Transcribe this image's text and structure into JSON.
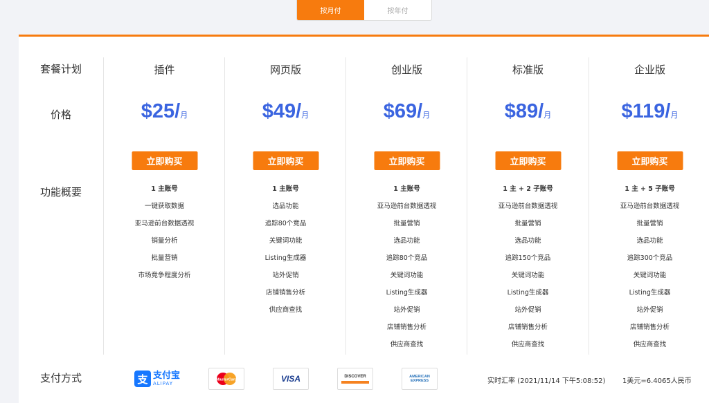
{
  "billing_toggle": {
    "monthly": "按月付",
    "yearly": "按年付"
  },
  "labels": {
    "plan": "套餐计划",
    "price": "价格",
    "features": "功能概要",
    "payment": "支付方式"
  },
  "plans": [
    {
      "name": "插件",
      "price": "$25/",
      "unit": "月",
      "buy": "立即购买",
      "features": [
        "1 主账号",
        "一键获取数据",
        "亚马逊前台数据透视",
        "销量分析",
        "批量营销",
        "市场竞争程度分析"
      ]
    },
    {
      "name": "网页版",
      "price": "$49/",
      "unit": "月",
      "buy": "立即购买",
      "features": [
        "1 主账号",
        "选品功能",
        "追踪80个竞品",
        "关键词功能",
        "Listing生成器",
        "站外促销",
        "店铺销售分析",
        "供应商查找"
      ]
    },
    {
      "name": "创业版",
      "price": "$69/",
      "unit": "月",
      "buy": "立即购买",
      "features": [
        "1 主账号",
        "亚马逊前台数据透视",
        "批量营销",
        "选品功能",
        "追踪80个竞品",
        "关键词功能",
        "Listing生成器",
        "站外促销",
        "店铺销售分析",
        "供应商查找"
      ]
    },
    {
      "name": "标准版",
      "price": "$89/",
      "unit": "月",
      "buy": "立即购买",
      "features": [
        "1 主 + 2 子账号",
        "亚马逊前台数据透视",
        "批量营销",
        "选品功能",
        "追踪150个竞品",
        "关键词功能",
        "Listing生成器",
        "站外促销",
        "店铺销售分析",
        "供应商查找"
      ]
    },
    {
      "name": "企业版",
      "price": "$119/",
      "unit": "月",
      "buy": "立即购买",
      "features": [
        "1 主 + 5 子账号",
        "亚马逊前台数据透视",
        "批量营销",
        "选品功能",
        "追踪300个竞品",
        "关键词功能",
        "Listing生成器",
        "站外促销",
        "店铺销售分析",
        "供应商查找"
      ]
    }
  ],
  "payment": {
    "alipay_glyph": "支",
    "alipay_cn": "支付宝",
    "alipay_en": "ALIPAY",
    "mastercard": "MasterCard",
    "visa": "VISA",
    "discover": "DISCOVER",
    "amex_line1": "AMERICAN",
    "amex_line2": "EXPRESS"
  },
  "exchange": {
    "realtime": "实时汇率 (2021/11/14 下午5:08:52)",
    "rate": "1美元=6.4065人民币"
  },
  "colors": {
    "accent": "#f77b0e",
    "price_blue": "#3a64e0",
    "alipay_blue": "#1677ff"
  }
}
